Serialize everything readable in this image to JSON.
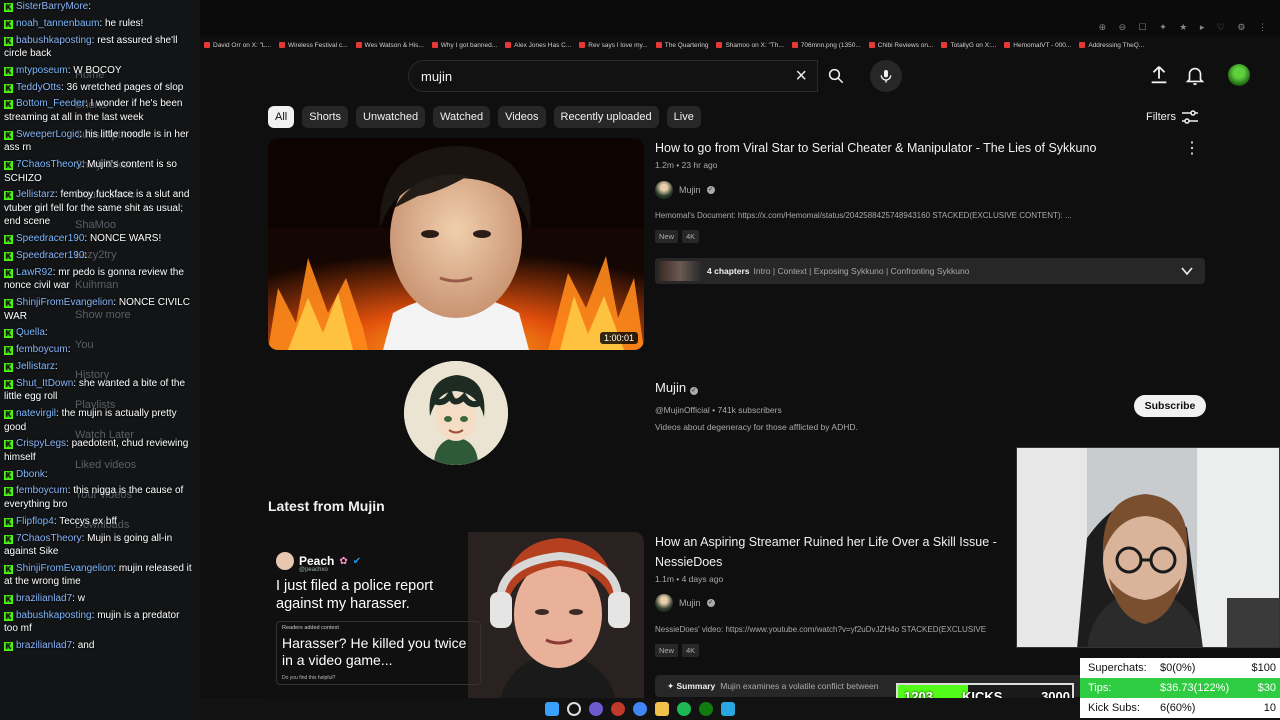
{
  "chat": {
    "messages": [
      {
        "user": "SisterBarryMore",
        "text": ""
      },
      {
        "user": "noah_tannenbaum",
        "text": "he rules!"
      },
      {
        "user": "babushkaposting",
        "text": "rest assured she'll circle back"
      },
      {
        "user": "mtyposeum",
        "text": "W BOCOY"
      },
      {
        "user": "TeddyOtts",
        "text": "36 wretched pages of slop"
      },
      {
        "user": "Bottom_Feeder",
        "text": "I wonder if he's been streaming at all in the last week"
      },
      {
        "user": "SweeperLogic",
        "text": "his little noodle is in her ass rn"
      },
      {
        "user": "7ChaosTheory",
        "text": "Mujin's content is so SCHIZO"
      },
      {
        "user": "Jellistarz",
        "text": "femboy fuckface is a slut and vtuber girl fell for the same shit as usual; end scene"
      },
      {
        "user": "Speedracer190",
        "text": "NONCE WARS!"
      },
      {
        "user": "Speedracer190",
        "text": ""
      },
      {
        "user": "LawR92",
        "text": "mr pedo is gonna review the nonce civil war"
      },
      {
        "user": "ShinjiFromEvangelion",
        "text": "NONCE CIVILC WAR"
      },
      {
        "user": "Quella",
        "text": ""
      },
      {
        "user": "femboycum",
        "text": ""
      },
      {
        "user": "Jellistarz",
        "text": ""
      },
      {
        "user": "Shut_ItDown",
        "text": "she wanted a bite of the little egg roll"
      },
      {
        "user": "natevirgil",
        "text": "the mujin is actually pretty good"
      },
      {
        "user": "CrispyLegs",
        "text": "paedotent, chud reviewing himself"
      },
      {
        "user": "Dbonk",
        "text": ""
      },
      {
        "user": "femboycum",
        "text": "this nigga is the cause of everything bro"
      },
      {
        "user": "Flipflop4",
        "text": "Teccys ex bff"
      },
      {
        "user": "7ChaosTheory",
        "text": "Mujin is going all-in against Sike"
      },
      {
        "user": "ShinjiFromEvangelion",
        "text": "mujin released it at the wrong time"
      },
      {
        "user": "brazilianlad7",
        "text": "w"
      },
      {
        "user": "babushkaposting",
        "text": "mujin is a predator too mf"
      },
      {
        "user": "brazilianlad7",
        "text": "and"
      }
    ],
    "ghost_sidebar": [
      "Home",
      "Shorts",
      "Subscriptions",
      "Shinji Tokens",
      "Liquid Sonic",
      "ShaMoo",
      "Lazy2try",
      "Kuihman",
      "Show more",
      "You",
      "History",
      "Playlists",
      "Watch Later",
      "Liked videos",
      "Your videos",
      "Downloads"
    ]
  },
  "bookmarks": [
    "David Orr on X: \"L...",
    "Wireless Festival c...",
    "Wes Watson & His...",
    "Why I got banned...",
    "Alex Jones Has C...",
    "Rev says I love my...",
    "The Quartering",
    "Shamoo on X: \"Th...",
    "706mnn.png (1350...",
    "Chibi Reviews on...",
    "TotallyG on X:...",
    "HemomalVT - 000...",
    "Addressing TheQ..."
  ],
  "search": {
    "query": "mujin"
  },
  "filters": {
    "chips": [
      "All",
      "Shorts",
      "Unwatched",
      "Watched",
      "Videos",
      "Recently uploaded",
      "Live"
    ],
    "active": "All",
    "filters_label": "Filters"
  },
  "video1": {
    "title": "How to go from Viral Star to Serial Cheater & Manipulator - The Lies of Sykkuno",
    "views": "1.2m",
    "age": "23 hr ago",
    "meta": "1.2m • 23 hr ago",
    "channel": "Mujin",
    "description": "Hemomal's Document: https://x.com/Hemomal/status/2042588425748943160 STACKED(EXCLUSIVE CONTENT): ...",
    "badges": [
      "New",
      "4K"
    ],
    "duration": "1:00:01",
    "chapters_label": "4 chapters",
    "chapters_list": "Intro | Context | Exposing Sykkuno | Confronting Sykkuno"
  },
  "channel": {
    "name": "Mujin",
    "handle_subs": "@MujinOfficial • 741k subscribers",
    "about": "Videos about degeneracy for those afflicted by ADHD.",
    "subscribe_label": "Subscribe"
  },
  "latest_heading": "Latest from Mujin",
  "video2": {
    "title": "How an Aspiring Streamer Ruined her Life Over a Skill Issue - NessieDoes",
    "meta": "1.1m • 4 days ago",
    "channel": "Mujin",
    "description": "NessieDoes' video: https://www.youtube.com/watch?v=yf2uDvJZH4o STACKED(EXCLUSIVE",
    "badges": [
      "New",
      "4K"
    ],
    "summary_label": "Summary",
    "summary_text": "Mujin examines a volatile conflict between",
    "tweet_name": "Peach",
    "tweet_handle": "@peachxo",
    "tweet_body": "I just filed a police report against my harasser.",
    "tweet_context_label": "Readers added context",
    "tweet_reply": "Harasser? He killed you twice in a video game...",
    "tweet_footer": "Do you find this helpful?"
  },
  "stream": {
    "superchats": {
      "label": "Superchats:",
      "value": "$0(0%)",
      "goal": "$100"
    },
    "tips": {
      "label": "Tips:",
      "value": "$36.73(122%)",
      "goal": "$30"
    },
    "kick_subs": {
      "label": "Kick Subs:",
      "value": "6(60%)",
      "goal": "10"
    },
    "kicks": {
      "current": "1203",
      "label": "KICKS",
      "goal": "3000",
      "fraction": 0.401
    },
    "colors": {
      "kick_green": "#53fc18",
      "tips_bar": "#2ecc40"
    }
  },
  "colors": {
    "background": "#0f0f0f",
    "chip": "#272727",
    "accent_red": "#ff0000"
  }
}
